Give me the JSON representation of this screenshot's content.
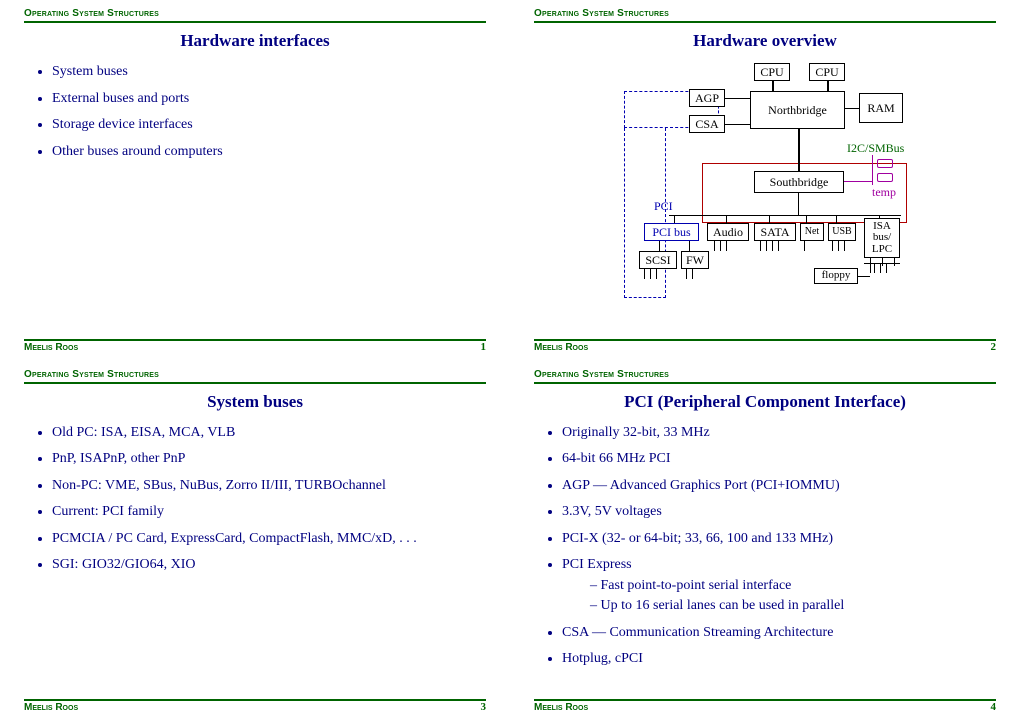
{
  "section_label": "Operating System Structures",
  "author": "Meelis Roos",
  "slide1": {
    "title": "Hardware interfaces",
    "b1": "System buses",
    "b2": "External buses and ports",
    "b3": "Storage device interfaces",
    "b4": "Other buses around computers",
    "page": "1"
  },
  "slide2": {
    "title": "Hardware overview",
    "page": "2",
    "d": {
      "cpu1": "CPU",
      "cpu2": "CPU",
      "agp": "AGP",
      "csa": "CSA",
      "nb": "Northbridge",
      "ram": "RAM",
      "sb": "Southbridge",
      "i2c": "I2C/SMBus",
      "temp": "temp",
      "pci_lbl": "PCI",
      "pcibus": "PCI bus",
      "audio": "Audio",
      "sata": "SATA",
      "net": "Net",
      "usb": "USB",
      "isa": "ISA bus/ LPC",
      "scsi": "SCSI",
      "fw": "FW",
      "floppy": "floppy"
    }
  },
  "slide3": {
    "title": "System buses",
    "b1": "Old PC: ISA, EISA, MCA, VLB",
    "b2": "PnP, ISAPnP, other PnP",
    "b3": "Non-PC: VME, SBus, NuBus, Zorro II/III, TURBOchannel",
    "b4": "Current: PCI family",
    "b5": "PCMCIA / PC Card, ExpressCard, CompactFlash, MMC/xD, . . .",
    "b6": "SGI: GIO32/GIO64, XIO",
    "page": "3"
  },
  "slide4": {
    "title": "PCI (Peripheral Component Interface)",
    "b1": "Originally 32-bit, 33 MHz",
    "b2": "64-bit 66 MHz PCI",
    "b3": "AGP — Advanced Graphics Port (PCI+IOMMU)",
    "b4": "3.3V, 5V voltages",
    "b5": "PCI-X (32- or 64-bit; 33, 66, 100 and 133 MHz)",
    "b6": "PCI Express",
    "b6a": "Fast point-to-point serial interface",
    "b6b": "Up to 16 serial lanes can be used in parallel",
    "b7": "CSA — Communication Streaming Architecture",
    "b8": "Hotplug, cPCI",
    "page": "4"
  }
}
